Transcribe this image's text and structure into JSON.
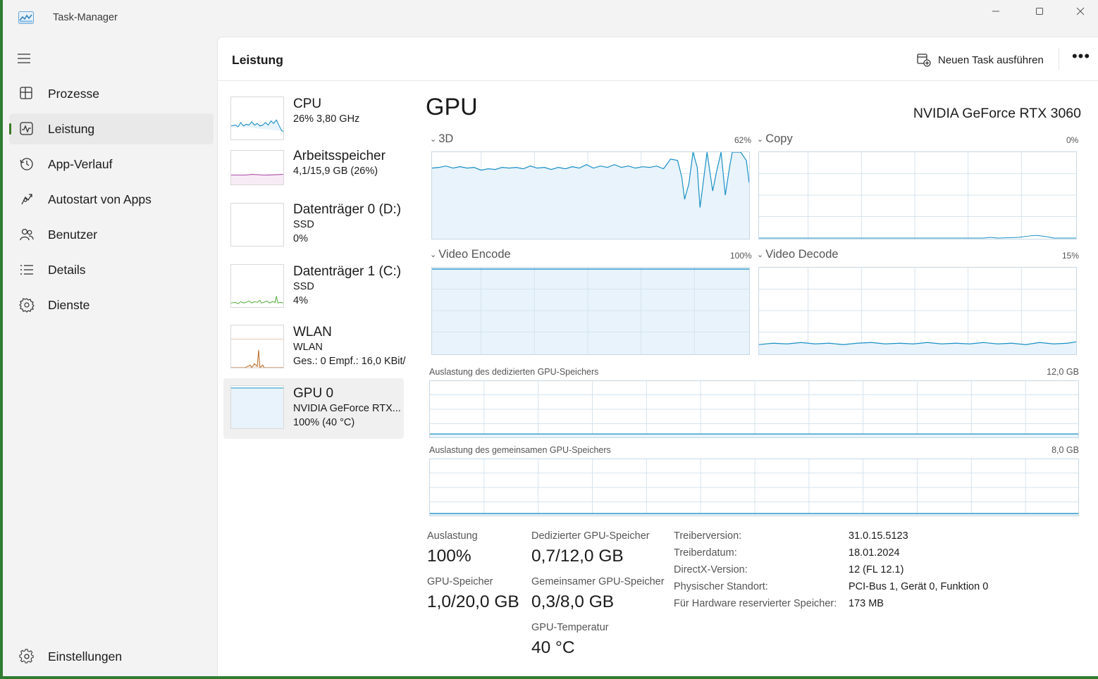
{
  "window": {
    "title": "Task-Manager",
    "accent_color": "#2e7d32"
  },
  "nav": {
    "items": [
      {
        "label": "Prozesse",
        "icon": "processes-icon"
      },
      {
        "label": "Leistung",
        "icon": "performance-icon",
        "active": true
      },
      {
        "label": "App-Verlauf",
        "icon": "history-icon"
      },
      {
        "label": "Autostart von Apps",
        "icon": "startup-icon"
      },
      {
        "label": "Benutzer",
        "icon": "users-icon"
      },
      {
        "label": "Details",
        "icon": "details-icon"
      },
      {
        "label": "Dienste",
        "icon": "services-icon"
      }
    ],
    "settings": {
      "label": "Einstellungen",
      "icon": "gear-icon"
    }
  },
  "header": {
    "title": "Leistung",
    "new_task_label": "Neuen Task ausführen",
    "more_label": "•••"
  },
  "resources": [
    {
      "name": "CPU",
      "sub1": "26%  3,80 GHz",
      "color": "#1a8fc5"
    },
    {
      "name": "Arbeitsspeicher",
      "sub1": "4,1/15,9 GB (26%)",
      "color": "#a3359b"
    },
    {
      "name": "Datenträger 0 (D:)",
      "sub1": "SSD",
      "sub2": "0%",
      "color": "#4da832"
    },
    {
      "name": "Datenträger 1 (C:)",
      "sub1": "SSD",
      "sub2": "4%",
      "color": "#4da832"
    },
    {
      "name": "WLAN",
      "sub1": "WLAN",
      "sub2": "Ges.: 0  Empf.: 16,0 KBit/",
      "color": "#b86d2a"
    },
    {
      "name": "GPU 0",
      "sub1": "NVIDIA GeForce RTX...",
      "sub2": "100%  (40 °C)",
      "color": "#1a8fc5",
      "active": true
    }
  ],
  "gpu": {
    "title": "GPU",
    "model": "NVIDIA GeForce RTX 3060",
    "engines": [
      {
        "label": "3D",
        "pct": "62%"
      },
      {
        "label": "Copy",
        "pct": "0%"
      },
      {
        "label": "Video Encode",
        "pct": "100%"
      },
      {
        "label": "Video Decode",
        "pct": "15%"
      }
    ],
    "dedicated_mem_label": "Auslastung des dedizierten GPU-Speichers",
    "dedicated_mem_max": "12,0 GB",
    "shared_mem_label": "Auslastung des gemeinsamen GPU-Speichers",
    "shared_mem_max": "8,0 GB",
    "stats": {
      "utilization_label": "Auslastung",
      "utilization_value": "100%",
      "gpu_mem_label": "GPU-Speicher",
      "gpu_mem_value": "1,0/20,0 GB",
      "dedicated_label": "Dedizierter GPU-Speicher",
      "dedicated_value": "0,7/12,0 GB",
      "shared_label": "Gemeinsamer GPU-Speicher",
      "shared_value": "0,3/8,0 GB",
      "temp_label": "GPU-Temperatur",
      "temp_value": "40 °C"
    },
    "info": [
      {
        "key": "Treiberversion:",
        "value": "31.0.15.5123"
      },
      {
        "key": "Treiberdatum:",
        "value": "18.01.2024"
      },
      {
        "key": "DirectX-Version:",
        "value": "12 (FL 12.1)"
      },
      {
        "key": "Physischer Standort:",
        "value": "PCI-Bus 1, Gerät 0, Funktion 0"
      },
      {
        "key": "Für Hardware reservierter Speicher:",
        "value": "173 MB"
      }
    ],
    "line_color": "#1a8fc5",
    "grid_color": "#d6e4ef"
  }
}
